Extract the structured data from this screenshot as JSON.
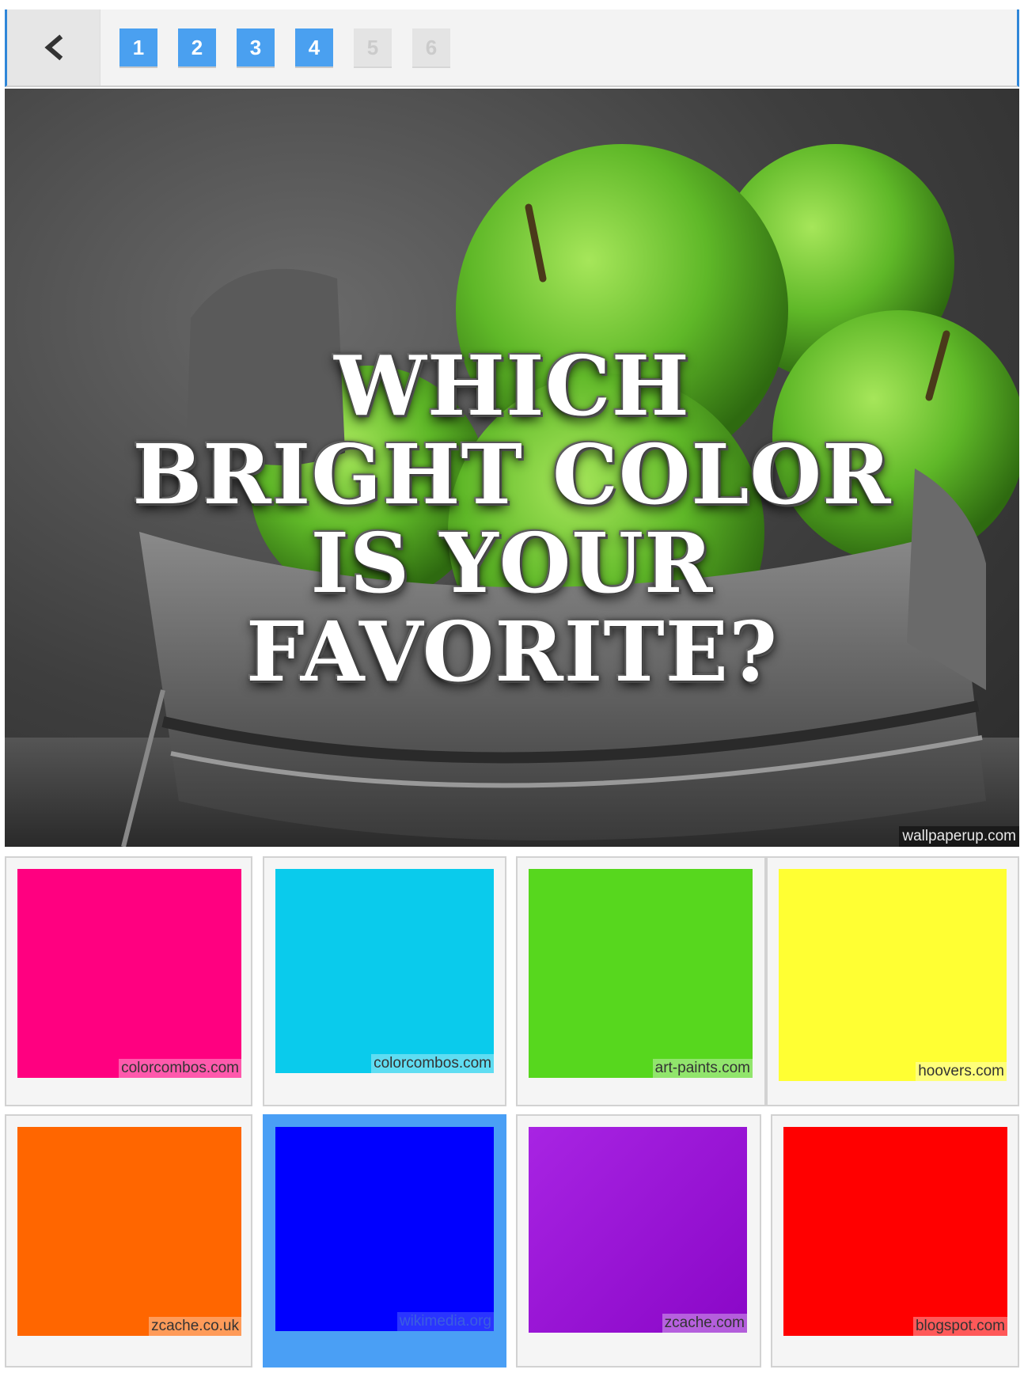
{
  "nav": {
    "back_icon": "chevron-left-icon",
    "pages": [
      {
        "label": "1",
        "enabled": true
      },
      {
        "label": "2",
        "enabled": true
      },
      {
        "label": "3",
        "enabled": true
      },
      {
        "label": "4",
        "enabled": true
      },
      {
        "label": "5",
        "enabled": false
      },
      {
        "label": "6",
        "enabled": false
      }
    ]
  },
  "hero": {
    "title_lines": [
      "WHICH",
      "BRIGHT COLOR",
      "IS YOUR",
      "FAVORITE?"
    ],
    "credit": "wallpaperup.com"
  },
  "options": [
    {
      "color": "#ff0080",
      "source": "colorcombos.com"
    },
    {
      "color": "#0acbec",
      "source": "colorcombos.com"
    },
    {
      "color": "#57d71e",
      "source": "art-paints.com"
    },
    {
      "color": "#ffff33",
      "source": "hoovers.com"
    },
    {
      "color": "#ff6600",
      "source": "zcache.co.uk"
    },
    {
      "color": "#0000ff",
      "source": "wikimedia.org",
      "selected": true
    },
    {
      "color": "#9a17d9",
      "source": "zcache.com"
    },
    {
      "color": "#ff0000",
      "source": "blogspot.com"
    }
  ]
}
